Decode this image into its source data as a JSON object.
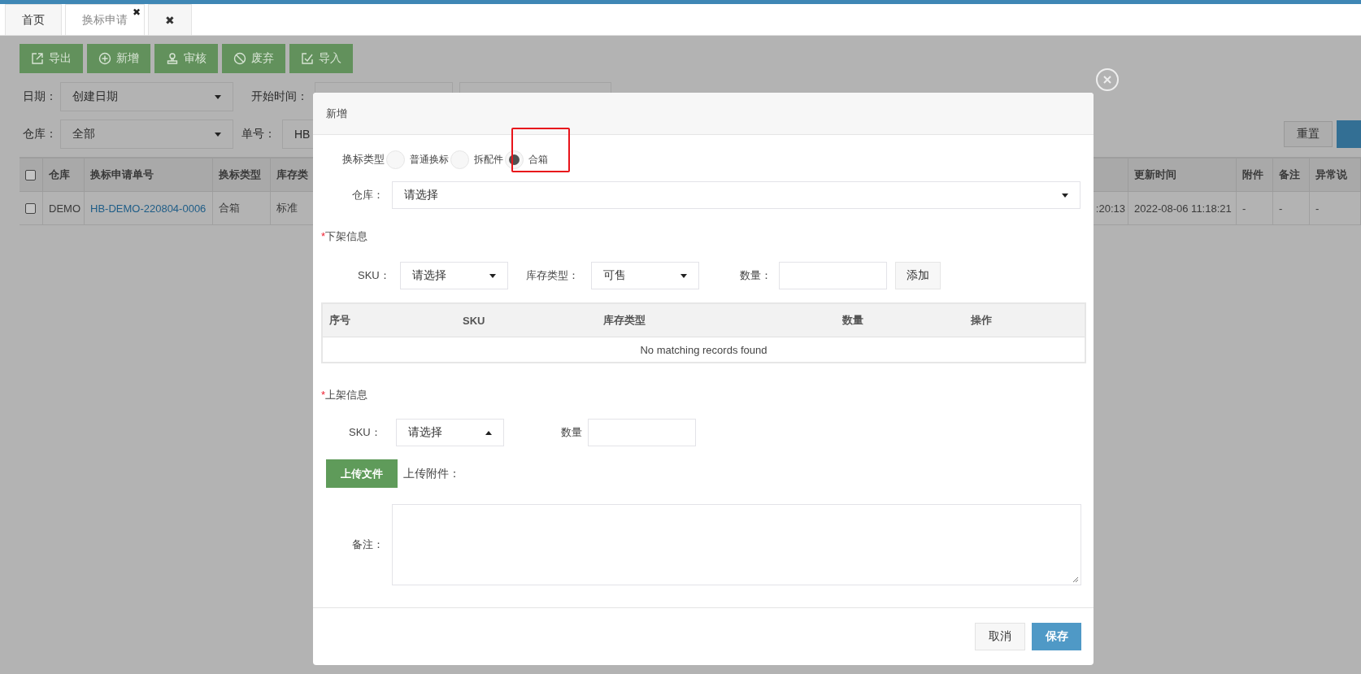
{
  "top_tabs": [
    {
      "label": "首页",
      "selected": false
    },
    {
      "label": "换标申请",
      "selected": true,
      "close": "✖"
    },
    {
      "label": "✖",
      "selected": false
    }
  ],
  "toolbar": [
    "导出",
    "新增",
    "审核",
    "废弃",
    "导入"
  ],
  "filters": {
    "date_label": "日期：",
    "date_value": "创建日期",
    "start_label": "开始时间：",
    "warehouse_label": "仓库：",
    "warehouse_value": "全部",
    "number_label": "单号：",
    "number_value": "HB",
    "reset_button": "重置"
  },
  "table": {
    "header_checked": false,
    "columns": [
      "仓库",
      "换标申请单号",
      "换标类型",
      "库存类"
    ],
    "right_columns": [
      "更新时间",
      "附件",
      "备注",
      "异常说"
    ],
    "rows": [
      {
        "checked": false,
        "cells": [
          "DEMO",
          "HB-DEMO-220804-0006",
          "合箱",
          "标准"
        ],
        "partial_cell": ":20:13",
        "right_cells": [
          "2022-08-06 11:18:21",
          "-",
          "-",
          "-"
        ]
      }
    ]
  },
  "dialog": {
    "title": "新增",
    "type_label": "换标类型",
    "type_options": [
      {
        "label": "普通换标",
        "selected": false
      },
      {
        "label": "拆配件",
        "selected": false
      },
      {
        "label": "合箱",
        "selected": true
      }
    ],
    "warehouse_label": "仓库：",
    "warehouse_value": "请选择",
    "offshelf": {
      "mark": "*",
      "title": "下架信息",
      "sku_label": "SKU：",
      "sku_value": "请选择",
      "stock_type_label": "库存类型：",
      "stock_type_value": "可售",
      "qty_label": "数量：",
      "add_button": "添加",
      "columns": [
        "序号",
        "SKU",
        "库存类型",
        "数量",
        "操作"
      ],
      "empty": "No matching records found"
    },
    "onshelf": {
      "mark": "*",
      "title": "上架信息",
      "sku_label": "SKU：",
      "sku_value": "请选择",
      "sku_open": true,
      "qty_label": "数量"
    },
    "upload_button": "上传文件",
    "upload_label": "上传附件：",
    "remark_label": "备注：",
    "cancel_button": "取消",
    "save_button": "保存"
  }
}
